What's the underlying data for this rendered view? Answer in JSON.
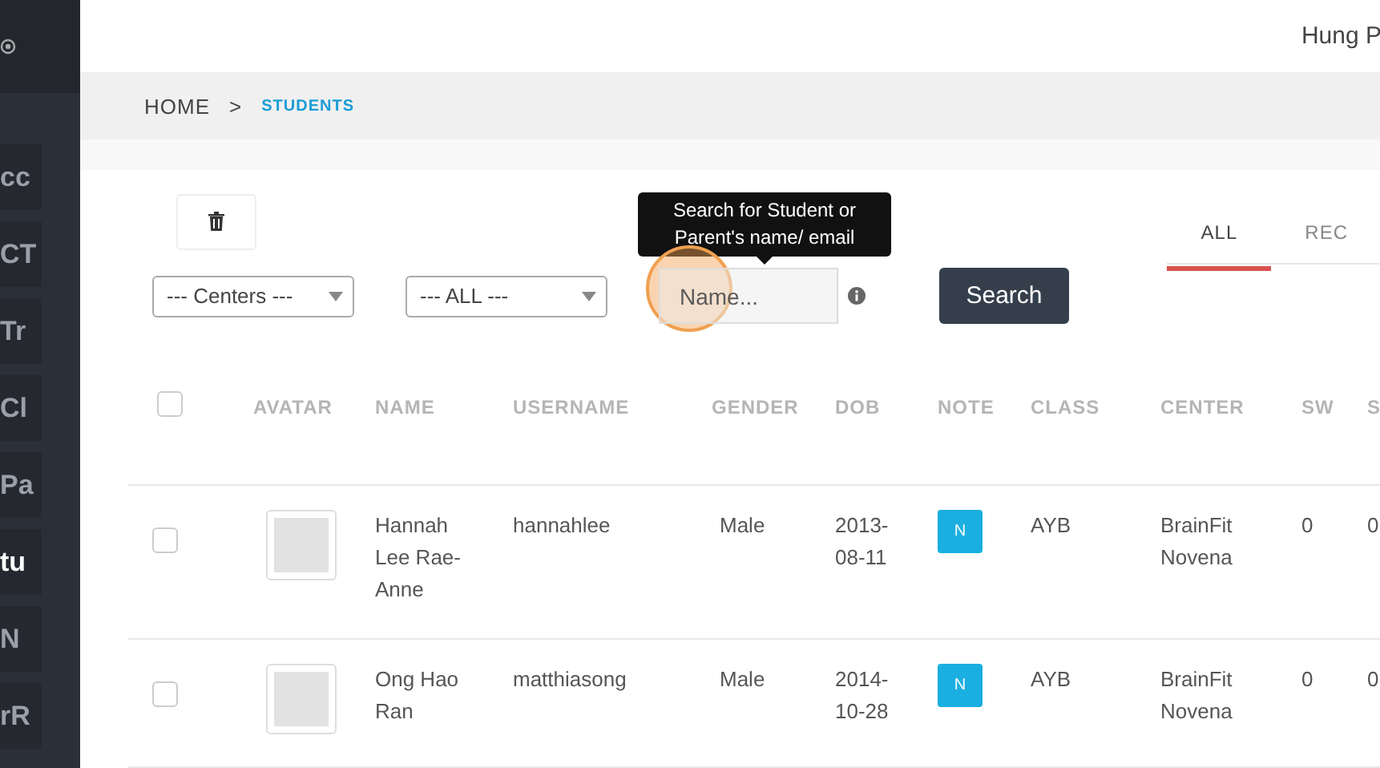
{
  "sidebar": {
    "items": [
      {
        "label": "cc",
        "selected": false
      },
      {
        "label": "CT",
        "selected": false
      },
      {
        "label": "Tr",
        "selected": false
      },
      {
        "label": "Cl",
        "selected": false
      },
      {
        "label": "Pa",
        "selected": false
      },
      {
        "label": "tu",
        "selected": true
      },
      {
        "label": "N",
        "selected": false
      },
      {
        "label": "rR",
        "selected": false
      }
    ]
  },
  "header": {
    "user": "Hung P"
  },
  "breadcrumb": {
    "home": "HOME",
    "separator": ">",
    "current": "STUDENTS"
  },
  "filters": {
    "center_select": "--- Centers ---",
    "class_select": "--- ALL ---",
    "search": {
      "placeholder": "Name...",
      "tooltip": "Search for Student or Parent's name/ email"
    },
    "search_button": "Search"
  },
  "tabs": [
    {
      "label": "ALL",
      "selected": true
    },
    {
      "label": "REC",
      "selected": false
    }
  ],
  "table": {
    "select_all_checked": false,
    "columns": [
      "AVATAR",
      "NAME",
      "USERNAME",
      "GENDER",
      "DOB",
      "NOTE",
      "CLASS",
      "CENTER",
      "SW",
      "S"
    ],
    "rows": [
      {
        "checked": false,
        "name": "Hannah Lee Rae-Anne",
        "username": "hannahlee",
        "gender": "Male",
        "dob": "2013-08-11",
        "note": "N",
        "class": "AYB",
        "center": "BrainFit Novena",
        "sw": "0",
        "column_11": "0"
      },
      {
        "checked": false,
        "name": "Ong Hao Ran",
        "username": "matthiasong",
        "gender": "Male",
        "dob": "2014-10-28",
        "note": "N",
        "class": "AYB",
        "center": "BrainFit Novena",
        "sw": "0",
        "column_11": "0"
      }
    ]
  }
}
